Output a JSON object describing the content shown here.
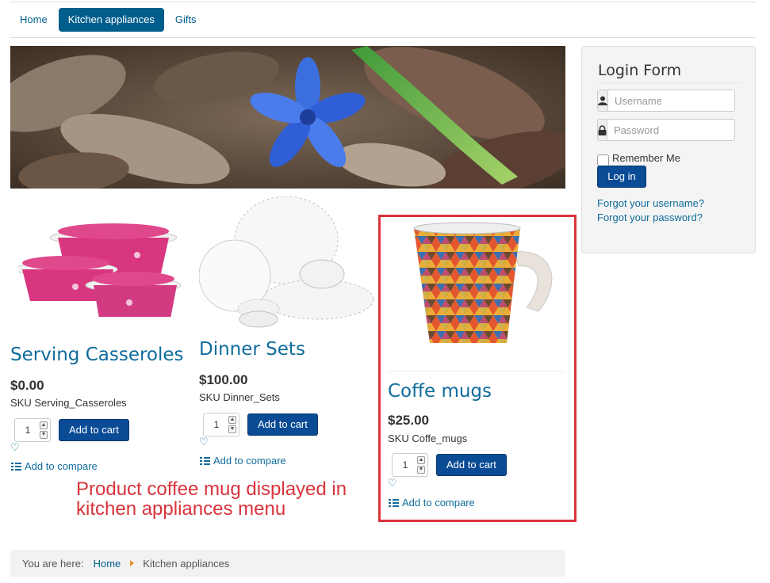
{
  "nav": {
    "items": [
      {
        "label": "Home",
        "active": false
      },
      {
        "label": "Kitchen appliances",
        "active": true
      },
      {
        "label": "Gifts",
        "active": false
      }
    ]
  },
  "products": [
    {
      "title": "Serving Casseroles",
      "price": "$0.00",
      "sku": "SKU Serving_Casseroles",
      "qty": "1",
      "add_to_cart": "Add to cart",
      "compare": "Add to compare"
    },
    {
      "title": "Dinner Sets",
      "price": "$100.00",
      "sku": "SKU Dinner_Sets",
      "qty": "1",
      "add_to_cart": "Add to cart",
      "compare": "Add to compare"
    },
    {
      "title": "Coffe mugs",
      "price": "$25.00",
      "sku": "SKU Coffe_mugs",
      "qty": "1",
      "add_to_cart": "Add to cart",
      "compare": "Add to compare"
    }
  ],
  "annotation": "Product coffee mug displayed in kitchen appliances menu",
  "login": {
    "title": "Login Form",
    "username_placeholder": "Username",
    "password_placeholder": "Password",
    "remember_label": "Remember Me",
    "login_button": "Log in",
    "forgot_username": "Forgot your username?",
    "forgot_password": "Forgot your password?"
  },
  "breadcrumb": {
    "label": "You are here:",
    "items": [
      "Home",
      "Kitchen appliances"
    ]
  },
  "colors": {
    "brand": "#005e8d",
    "button": "#0a4b95",
    "highlight": "#d9333b"
  }
}
